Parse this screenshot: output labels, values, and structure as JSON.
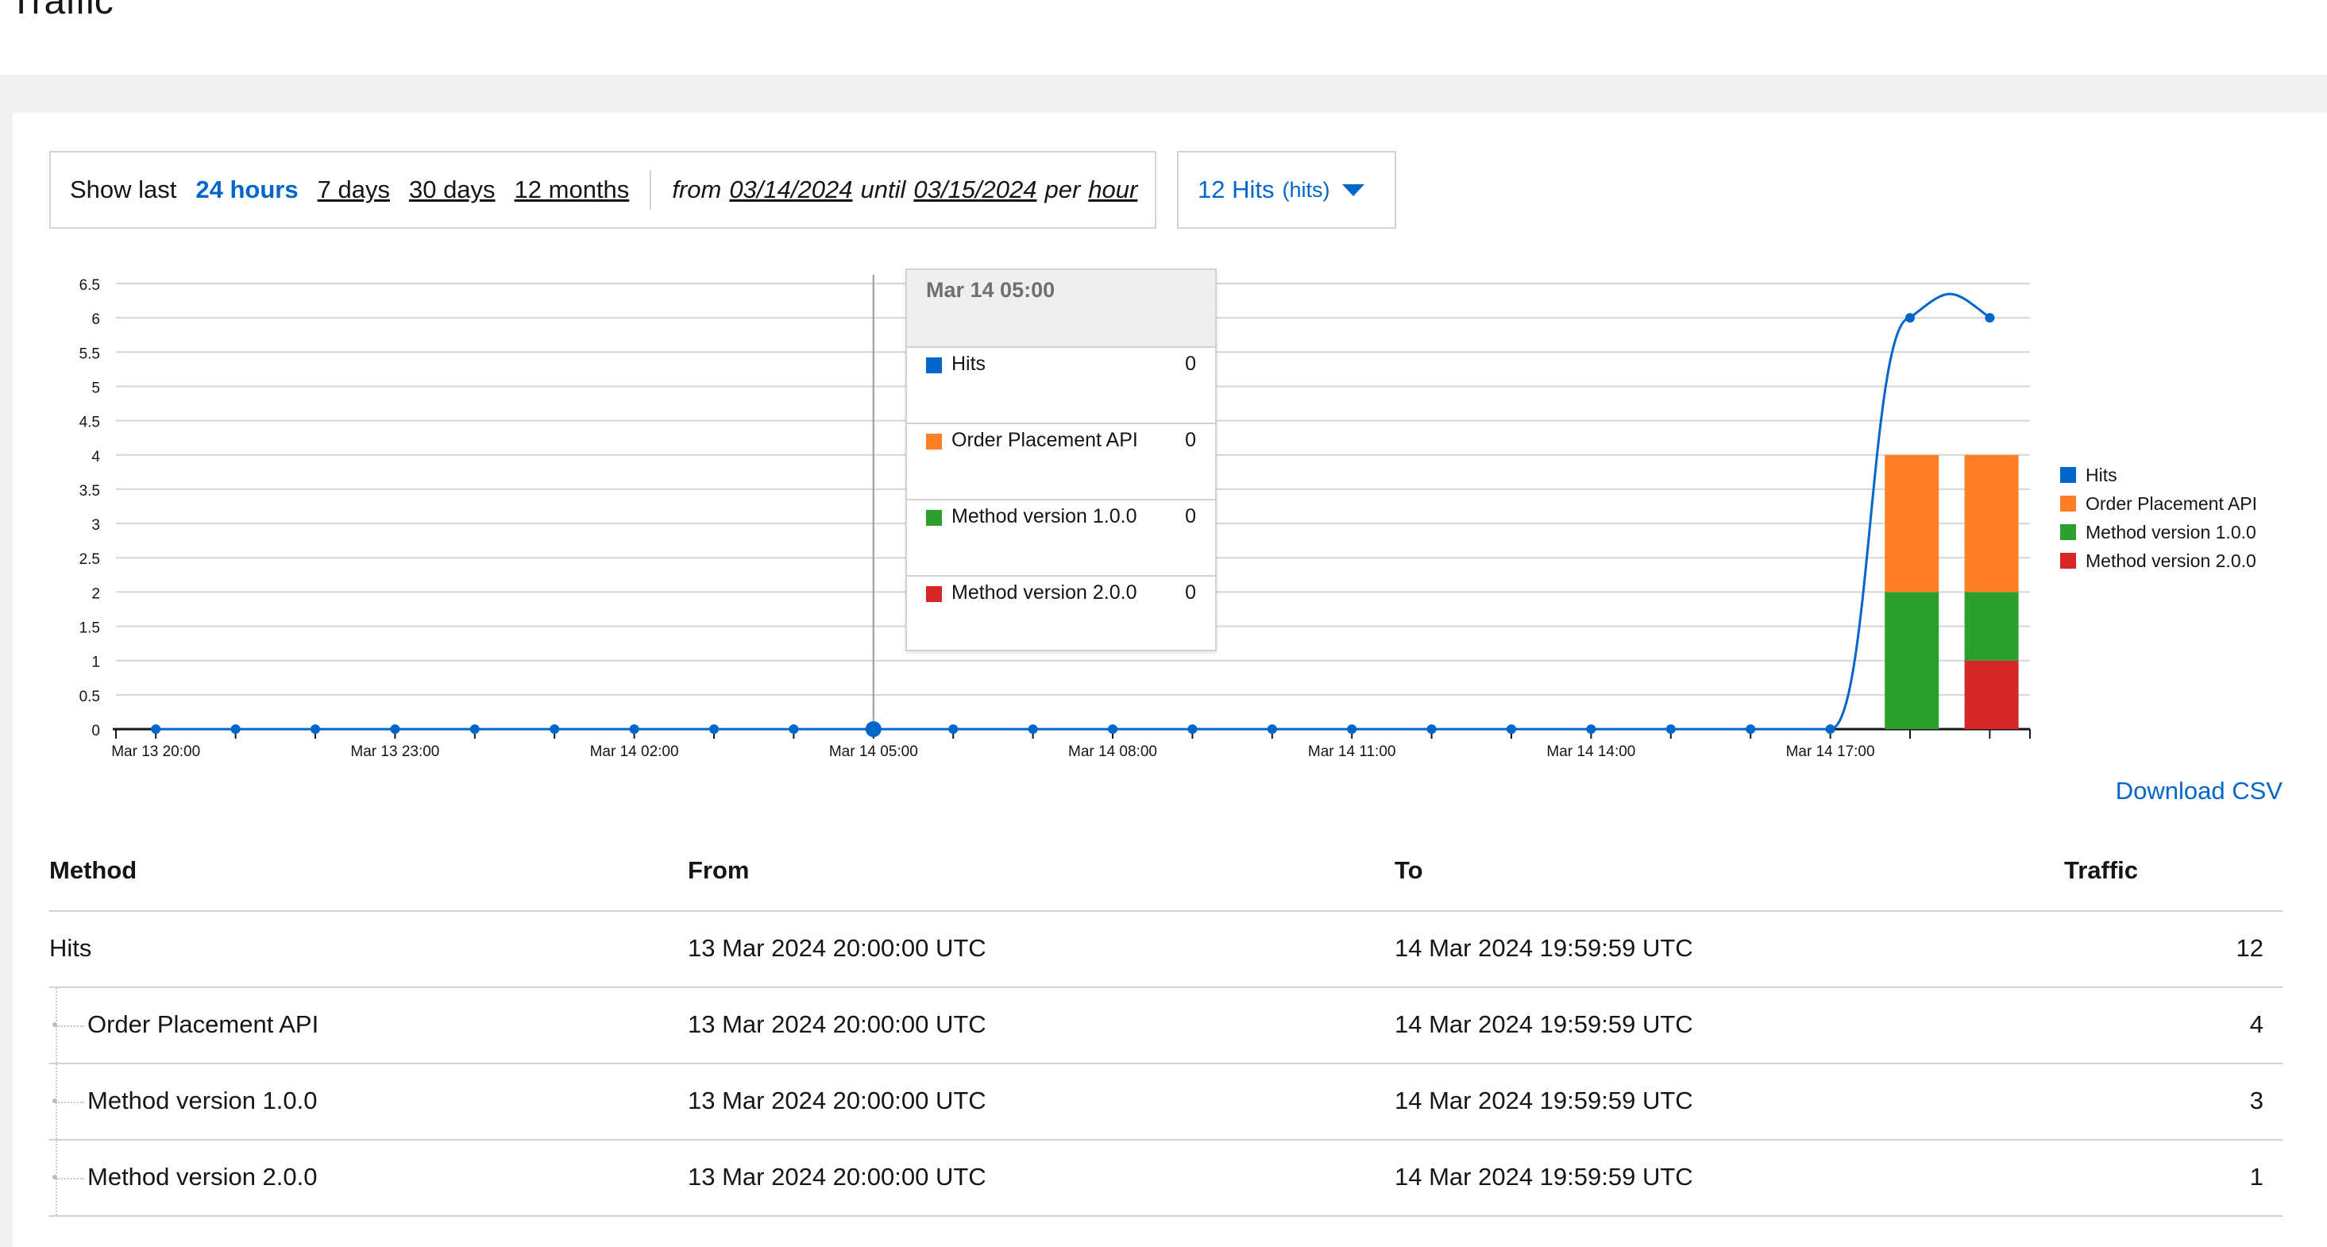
{
  "page": {
    "title": "Traffic"
  },
  "toolbar": {
    "show_last_label": "Show last",
    "options": [
      "24 hours",
      "7 days",
      "30 days",
      "12 months"
    ],
    "active_option": "24 hours",
    "range": {
      "from_label": "from",
      "from_date": "03/14/2024",
      "until_label": "until",
      "until_date": "03/15/2024",
      "per_label": "per",
      "granularity": "hour"
    }
  },
  "metric_select": {
    "label": "12 Hits",
    "unit": "(hits)"
  },
  "colors": {
    "hits": "#06c",
    "order_placement": "#ff7f27",
    "method_v1": "#2ca02c",
    "method_v2": "#d62728",
    "accent": "#0066cc"
  },
  "chart_data": {
    "type": "bar",
    "x_tick_labels": [
      "Mar 13 20:00",
      "Mar 13 23:00",
      "Mar 14 02:00",
      "Mar 14 05:00",
      "Mar 14 08:00",
      "Mar 14 11:00",
      "Mar 14 14:00",
      "Mar 14 17:00"
    ],
    "y_tick_labels": [
      "0",
      "0.5",
      "1",
      "1.5",
      "2",
      "2.5",
      "3",
      "3.5",
      "4",
      "4.5",
      "5",
      "5.5",
      "6",
      "6.5"
    ],
    "ylim": [
      0,
      6.5
    ],
    "hours": [
      "Mar 13 20:00",
      "Mar 13 21:00",
      "Mar 13 22:00",
      "Mar 13 23:00",
      "Mar 14 00:00",
      "Mar 14 01:00",
      "Mar 14 02:00",
      "Mar 14 03:00",
      "Mar 14 04:00",
      "Mar 14 05:00",
      "Mar 14 06:00",
      "Mar 14 07:00",
      "Mar 14 08:00",
      "Mar 14 09:00",
      "Mar 14 10:00",
      "Mar 14 11:00",
      "Mar 14 12:00",
      "Mar 14 13:00",
      "Mar 14 14:00",
      "Mar 14 15:00",
      "Mar 14 16:00",
      "Mar 14 17:00",
      "Mar 14 18:00",
      "Mar 14 19:00"
    ],
    "series": [
      {
        "name": "Hits",
        "kind": "line",
        "values": [
          0,
          0,
          0,
          0,
          0,
          0,
          0,
          0,
          0,
          0,
          0,
          0,
          0,
          0,
          0,
          0,
          0,
          0,
          0,
          0,
          0,
          0,
          6,
          6
        ]
      },
      {
        "name": "Order Placement API",
        "kind": "bar",
        "values": [
          0,
          0,
          0,
          0,
          0,
          0,
          0,
          0,
          0,
          0,
          0,
          0,
          0,
          0,
          0,
          0,
          0,
          0,
          0,
          0,
          0,
          0,
          2,
          2
        ]
      },
      {
        "name": "Method version 1.0.0",
        "kind": "bar",
        "values": [
          0,
          0,
          0,
          0,
          0,
          0,
          0,
          0,
          0,
          0,
          0,
          0,
          0,
          0,
          0,
          0,
          0,
          0,
          0,
          0,
          0,
          0,
          2,
          1
        ]
      },
      {
        "name": "Method version 2.0.0",
        "kind": "bar",
        "values": [
          0,
          0,
          0,
          0,
          0,
          0,
          0,
          0,
          0,
          0,
          0,
          0,
          0,
          0,
          0,
          0,
          0,
          0,
          0,
          0,
          0,
          0,
          0,
          1
        ]
      }
    ],
    "stacked": true,
    "grid": true,
    "legend_position": "right",
    "hover_marker": "Mar 14 05:00"
  },
  "tooltip": {
    "title": "Mar 14 05:00",
    "rows": [
      {
        "name": "Hits",
        "value": "0"
      },
      {
        "name": "Order Placement API",
        "value": "0"
      },
      {
        "name": "Method version 1.0.0",
        "value": "0"
      },
      {
        "name": "Method version 2.0.0",
        "value": "0"
      }
    ]
  },
  "legend": [
    "Hits",
    "Order Placement API",
    "Method version 1.0.0",
    "Method version 2.0.0"
  ],
  "download": {
    "label": "Download CSV"
  },
  "table": {
    "headers": {
      "method": "Method",
      "from": "From",
      "to": "To",
      "traffic": "Traffic"
    },
    "rows": [
      {
        "method": "Hits",
        "from": "13 Mar 2024 20:00:00 UTC",
        "to": "14 Mar 2024 19:59:59 UTC",
        "traffic": "12"
      },
      {
        "method": "Order Placement API",
        "from": "13 Mar 2024 20:00:00 UTC",
        "to": "14 Mar 2024 19:59:59 UTC",
        "traffic": "4"
      },
      {
        "method": "Method version 1.0.0",
        "from": "13 Mar 2024 20:00:00 UTC",
        "to": "14 Mar 2024 19:59:59 UTC",
        "traffic": "3"
      },
      {
        "method": "Method version 2.0.0",
        "from": "13 Mar 2024 20:00:00 UTC",
        "to": "14 Mar 2024 19:59:59 UTC",
        "traffic": "1"
      }
    ]
  }
}
